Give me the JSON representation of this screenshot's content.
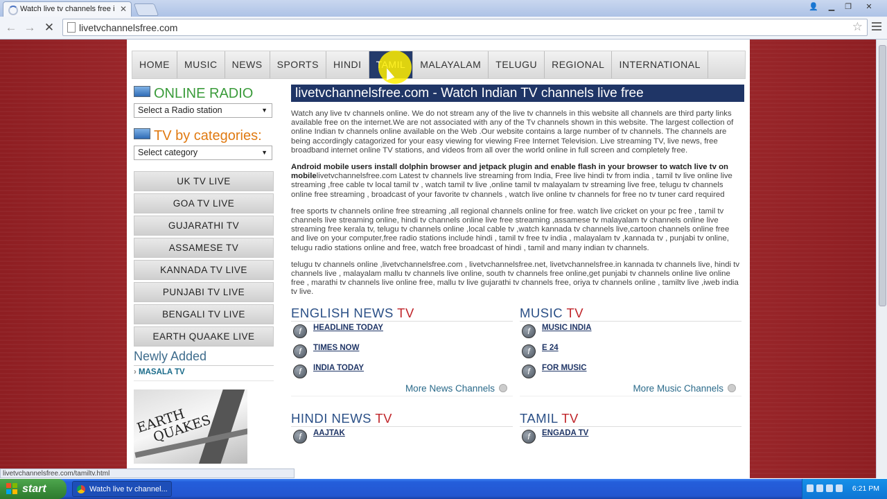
{
  "browser": {
    "tab_title": "Watch live tv channels free i",
    "url": "livetvchannelsfree.com",
    "status_url": "livetvchannelsfree.com/tamiltv.html"
  },
  "nav": [
    "HOME",
    "MUSIC",
    "NEWS",
    "SPORTS",
    "HINDI",
    "TAMIL",
    "MALAYALAM",
    "TELUGU",
    "REGIONAL",
    "INTERNATIONAL"
  ],
  "sidebar": {
    "radio_title": "ONLINE RADIO",
    "radio_select": "Select a Radio station",
    "tv_title": "TV by categories:",
    "tv_select": "Select category",
    "buttons": [
      "UK TV LIVE",
      "GOA TV LIVE",
      "GUJARATHI TV",
      "ASSAMESE TV",
      "KANNADA TV LIVE",
      "PUNJABI TV LIVE",
      "BENGALI TV LIVE",
      "EARTH QUAAKE LIVE"
    ],
    "newly_added": "Newly Added",
    "newly_item": "MASALA TV",
    "image_text": "EARTH\n   QUAKES"
  },
  "main": {
    "banner": "livetvchannelsfree.com - Watch Indian TV channels live free",
    "para1": "Watch any live tv channels online. We do not stream any of the live tv channels in this website all channels are third party links available free on the internet.We are not associated with any of the Tv channels shown in this website. The largest collection of online Indian tv channels online available on the Web .Our website contains a large number of tv channels. The channels are being accordingly catagorized for your easy viewing for viewing Free Internet Television. Live streaming TV, live news, free broadband internet online TV stations, and videos from all over the world online in full screen and completely free.",
    "para2_bold": "Android mobile users install dolphin browser and jetpack plugin and enable flash in your browser to watch live tv on mobile",
    "para2_rest": "livetvchannelsfree.com Latest tv channels live streaming from India, Free live hindi tv from india , tamil tv live online live streaming ,free cable tv local tamil tv , watch tamil tv live ,online tamil tv malayalam tv streaming live free, telugu tv channels online free streaming , broadcast of your favorite tv channels , watch live online tv channels for free no tv tuner card required",
    "para3": "free sports tv channels online free streaming ,all regional channels online for free. watch live cricket on your pc free , tamil tv channels live streaming online, hindi tv channels online live free streaming ,assamese tv malayalam tv channels online live streaming free kerala tv, telugu tv channels online ,local cable tv ,watch kannada tv channels live,cartoon channels online free and live on your computer,free radio stations include hindi , tamil tv free tv india , malayalam tv ,kannada tv , punjabi tv online, telugu radio stations online and free, watch free broadcast of hindi , tamil and many indian tv channels.",
    "para4": "telugu tv channels online ,livetvchannelsfree.com , livetvchannelsfree.net, livetvchannelsfree.in kannada tv channels live, hindi tv channels live , malayalam mallu tv channels live online, south tv channels free online,get punjabi tv channels online live online free , marathi tv channels live online free, mallu tv live gujarathi tv channels free, oriya tv channels online , tamiltv live ,iweb india tv live.",
    "categories": [
      {
        "title": "ENGLISH NEWS",
        "suffix": "TV",
        "channels": [
          "HEADLINE TODAY",
          "TIMES NOW",
          "INDIA TODAY"
        ],
        "more": "More News Channels"
      },
      {
        "title": "MUSIC",
        "suffix": "TV",
        "channels": [
          "MUSIC INDIA",
          "E 24",
          "FOR MUSIC"
        ],
        "more": "More Music Channels"
      },
      {
        "title": "HINDI NEWS",
        "suffix": "TV",
        "channels": [
          "AAJTAK"
        ]
      },
      {
        "title": "TAMIL",
        "suffix": "TV",
        "channels": [
          "ENGADA TV"
        ]
      }
    ]
  },
  "taskbar": {
    "start": "start",
    "item": "Watch live tv channel...",
    "clock": "6:21 PM"
  }
}
